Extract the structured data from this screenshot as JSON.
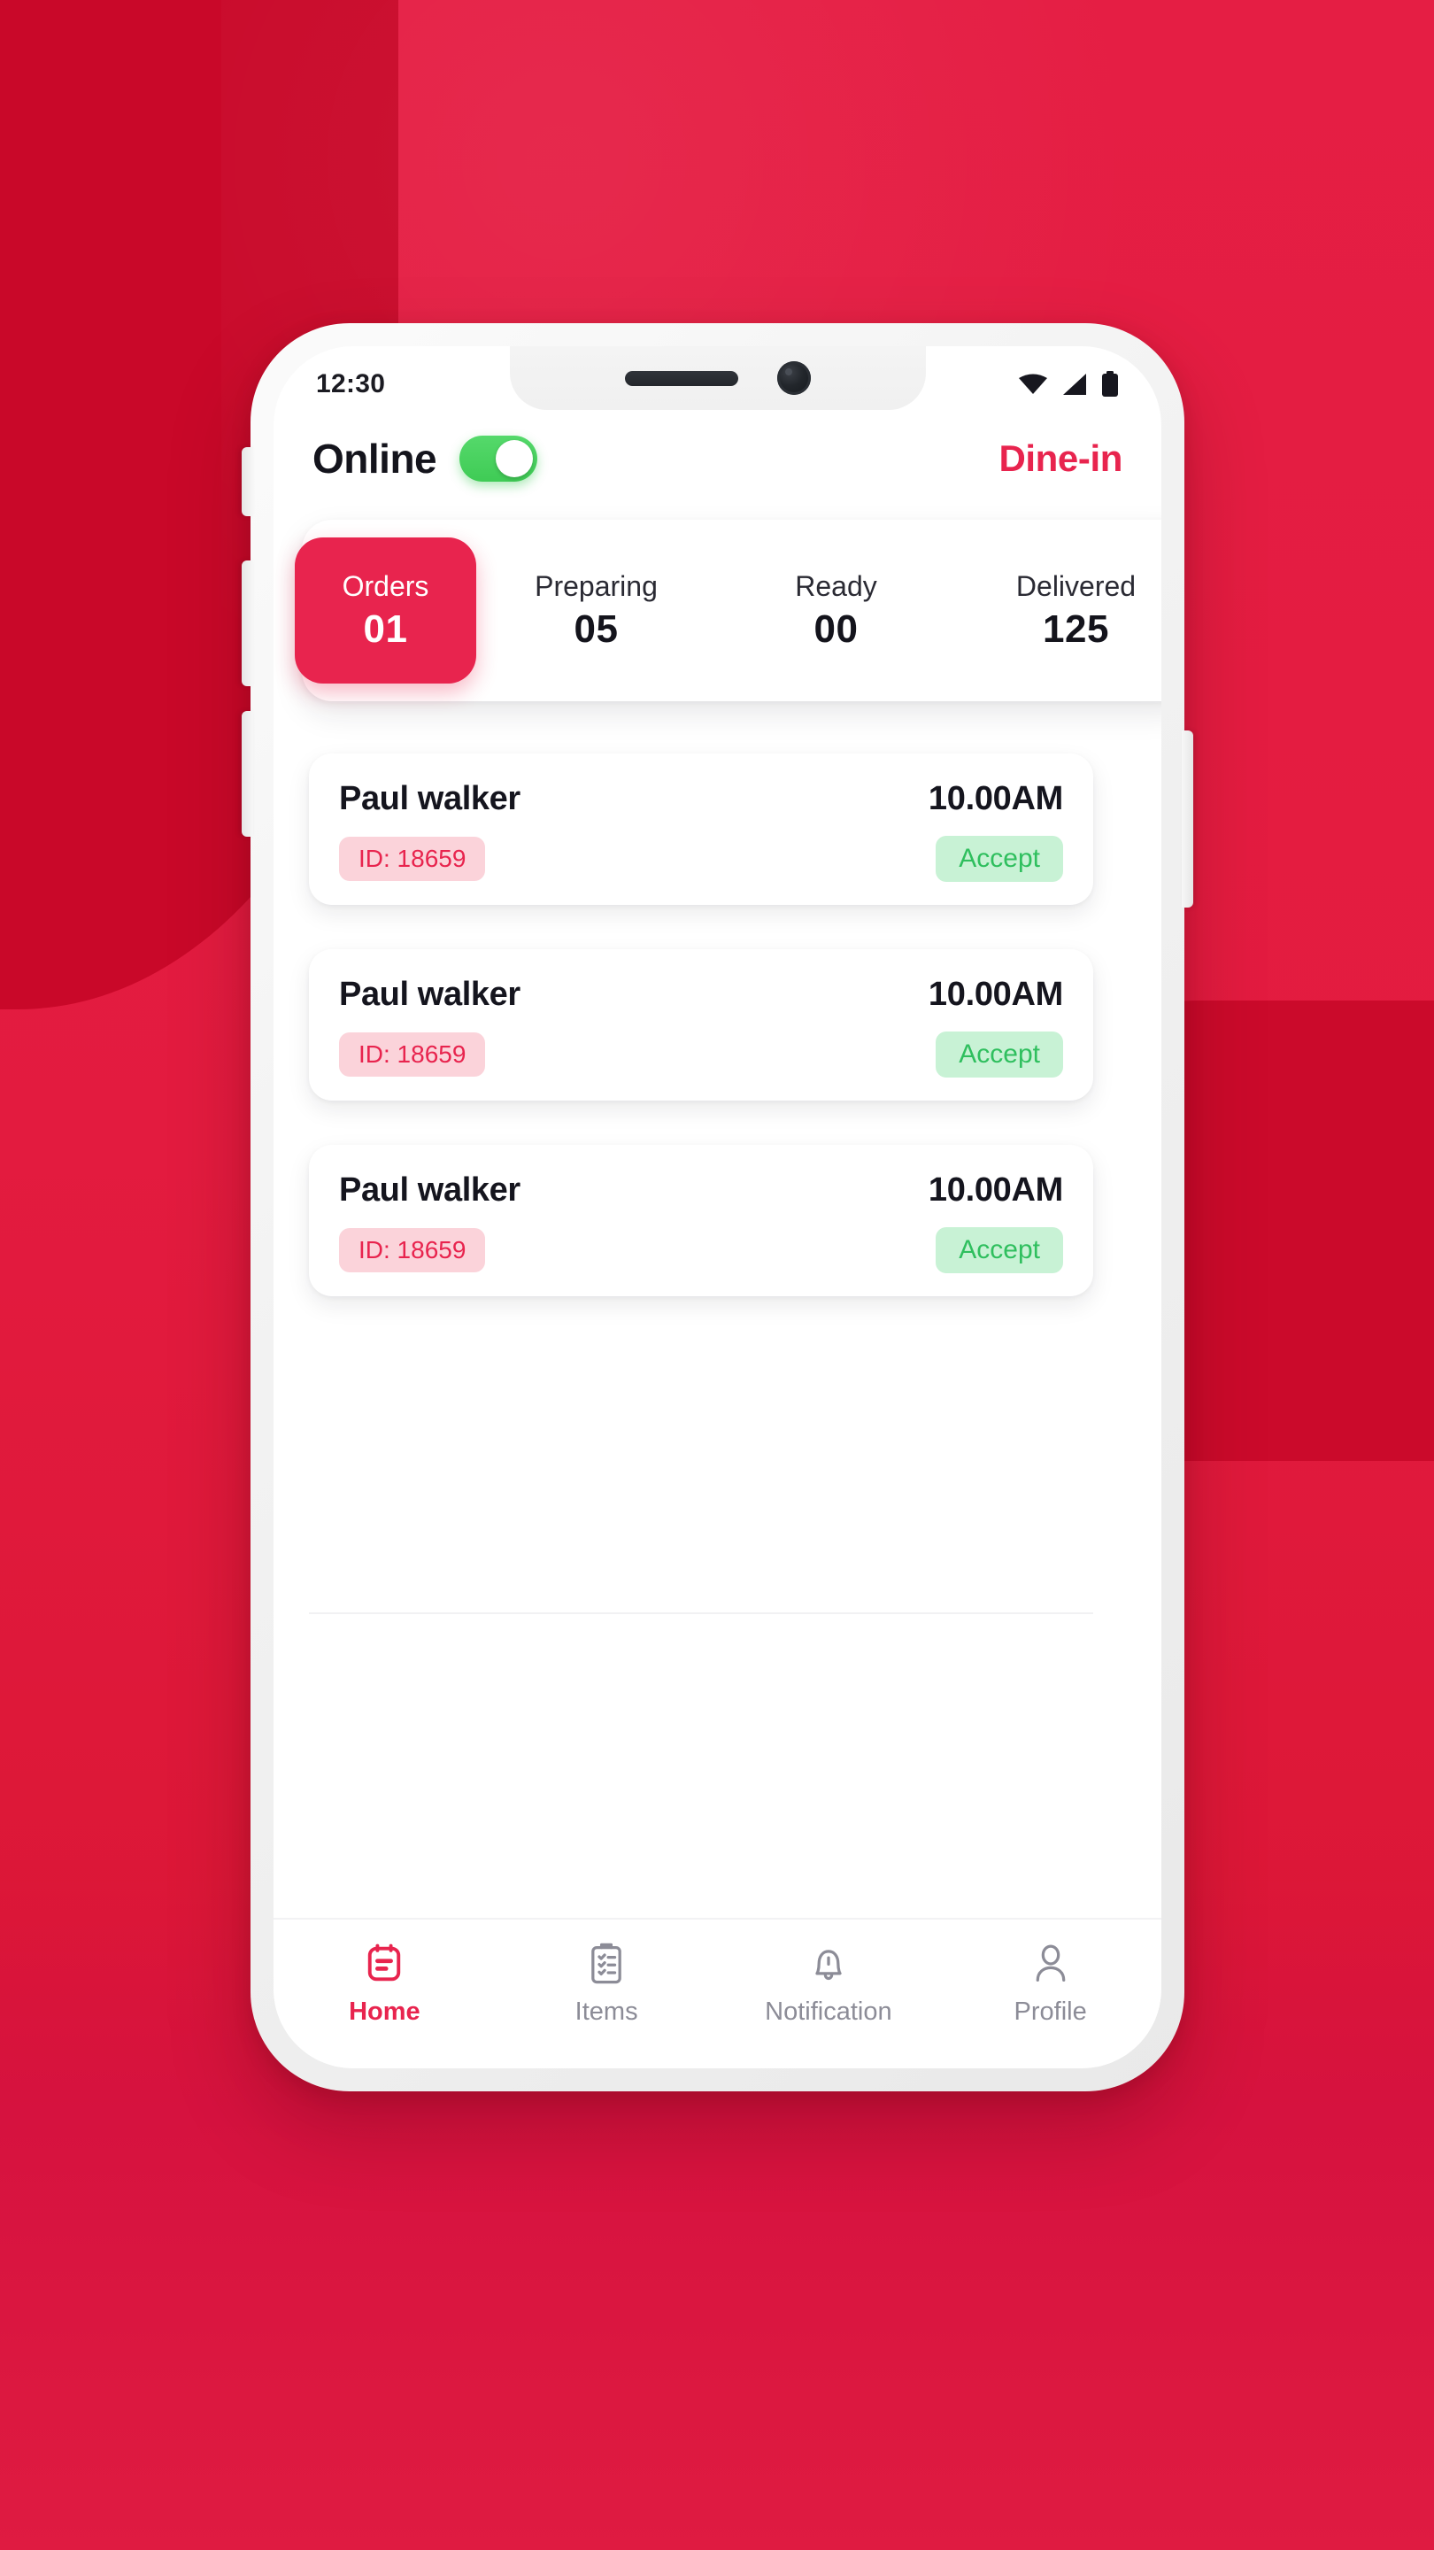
{
  "background": {
    "primary_red": "#E51E44",
    "dark_red": "#C90829",
    "accent": "#E8244E"
  },
  "status_bar": {
    "time": "12:30",
    "icons": [
      "wifi-icon",
      "signal-icon",
      "battery-icon"
    ]
  },
  "header": {
    "online_label": "Online",
    "toggle_state": "on",
    "toggle_color": "#3FCB55",
    "mode_label": "Dine-in",
    "mode_color": "#E8244E"
  },
  "stats": [
    {
      "label": "Orders",
      "value": "01",
      "active": true
    },
    {
      "label": "Preparing",
      "value": "05",
      "active": false
    },
    {
      "label": "Ready",
      "value": "00",
      "active": false
    },
    {
      "label": "Delivered",
      "value": "125",
      "active": false
    }
  ],
  "orders": [
    {
      "name": "Paul walker",
      "time": "10.00AM",
      "id": "ID: 18659",
      "action": "Accept"
    },
    {
      "name": "Paul walker",
      "time": "10.00AM",
      "id": "ID: 18659",
      "action": "Accept"
    },
    {
      "name": "Paul walker",
      "time": "10.00AM",
      "id": "ID: 18659",
      "action": "Accept"
    }
  ],
  "order_styles": {
    "id_bg": "#FBD3DA",
    "id_text": "#E8244E",
    "accept_bg": "#C8F2D5",
    "accept_text": "#2FBF5E"
  },
  "bottom_nav": [
    {
      "label": "Home",
      "icon": "receipt-icon",
      "active": true
    },
    {
      "label": "Items",
      "icon": "clipboard-icon",
      "active": false
    },
    {
      "label": "Notification",
      "icon": "bell-icon",
      "active": false
    },
    {
      "label": "Profile",
      "icon": "person-icon",
      "active": false
    }
  ]
}
